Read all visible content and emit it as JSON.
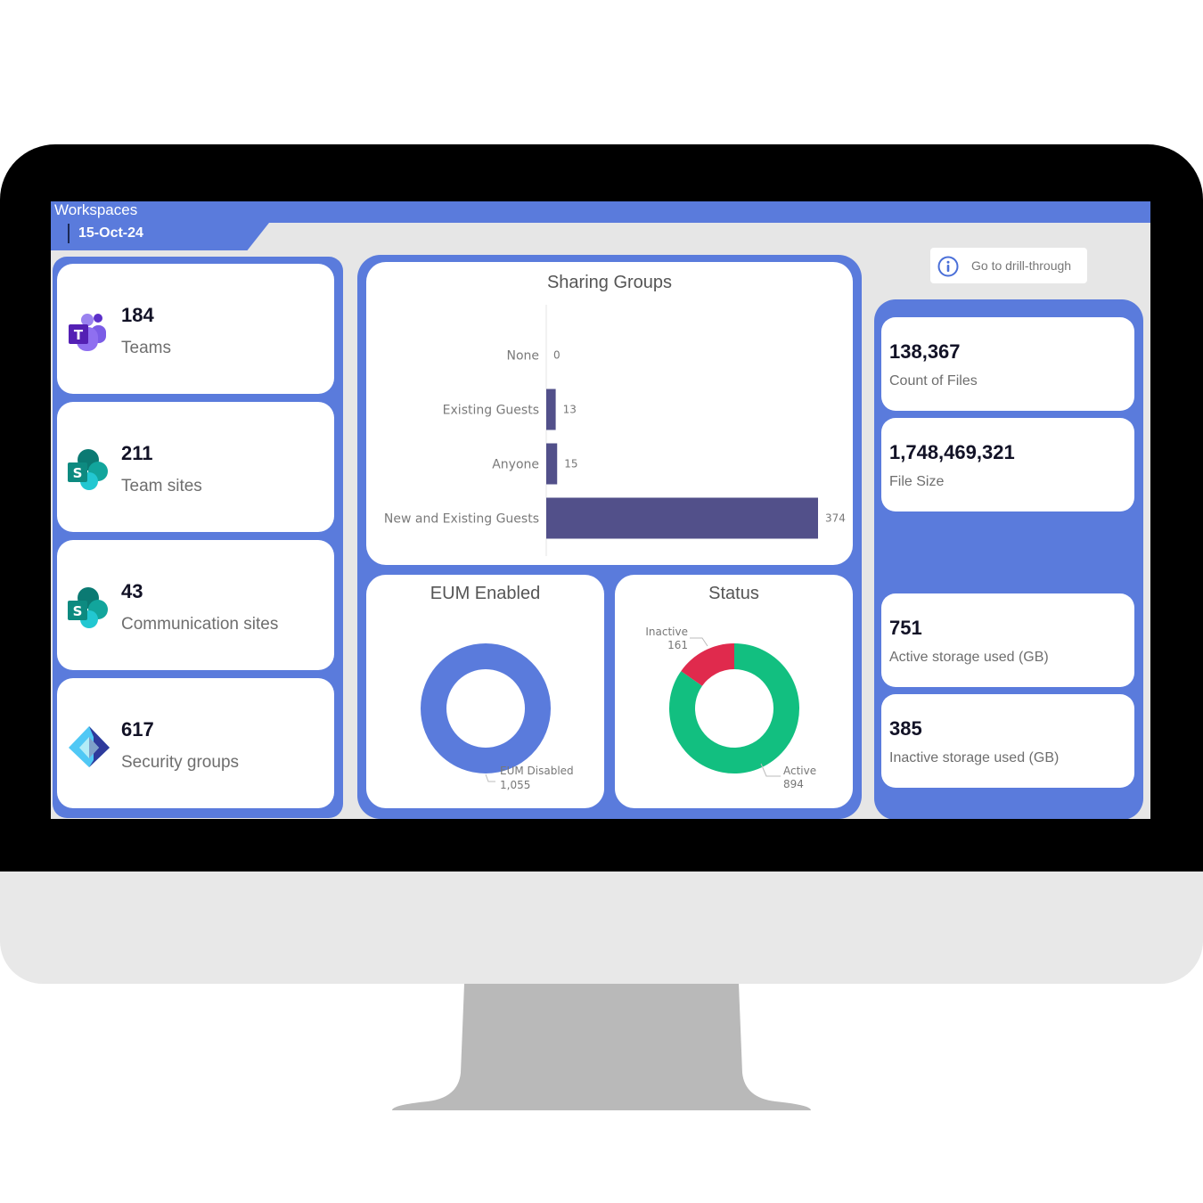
{
  "header": {
    "title": "Workspaces",
    "date": "15-Oct-24"
  },
  "left_kpis": [
    {
      "value": "184",
      "label": "Teams",
      "icon": "teams-icon"
    },
    {
      "value": "211",
      "label": "Team sites",
      "icon": "sharepoint-icon"
    },
    {
      "value": "43",
      "label": "Communication sites",
      "icon": "sharepoint-icon"
    },
    {
      "value": "617",
      "label": "Security groups",
      "icon": "entra-id-icon"
    }
  ],
  "drill_through": {
    "label": "Go to drill-through",
    "icon": "info-icon"
  },
  "right_kpis": [
    {
      "value": "138,367",
      "label": "Count of Files"
    },
    {
      "value": "1,748,469,321",
      "label": "File Size"
    },
    {
      "value": "751",
      "label": "Active storage used (GB)"
    },
    {
      "value": "385",
      "label": "Inactive storage used (GB)"
    }
  ],
  "colors": {
    "accent": "#5a7bdc",
    "bar": "#52508a",
    "active": "#12bf80",
    "inactive": "#e02a4d",
    "eum": "#5a7bdc"
  },
  "chart_data": [
    {
      "type": "bar",
      "orientation": "horizontal",
      "title": "Sharing Groups",
      "categories": [
        "None",
        "Existing Guests",
        "Anyone",
        "New and Existing Guests"
      ],
      "values": [
        0,
        13,
        15,
        374
      ],
      "data_labels": [
        "0",
        "13",
        "15",
        "374"
      ],
      "xlim": [
        0,
        374
      ],
      "grid": false
    },
    {
      "type": "pie",
      "donut": true,
      "title": "EUM Enabled",
      "labels": [
        "EUM Disabled"
      ],
      "values": [
        1055
      ],
      "data_labels": [
        "1,055"
      ]
    },
    {
      "type": "pie",
      "donut": true,
      "title": "Status",
      "labels": [
        "Active",
        "Inactive"
      ],
      "values": [
        894,
        161
      ],
      "data_labels": [
        "894",
        "161"
      ]
    }
  ]
}
